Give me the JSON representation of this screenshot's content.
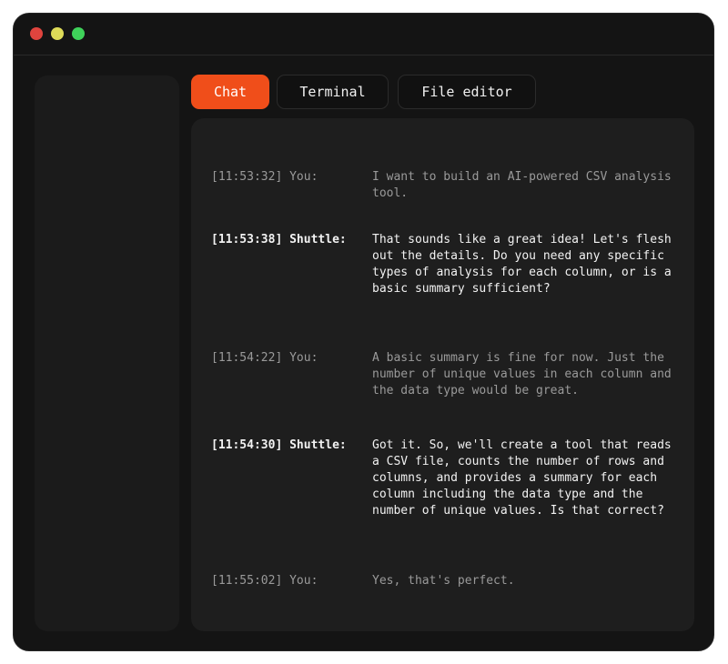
{
  "window": {
    "controls": [
      "close",
      "minimize",
      "maximize"
    ]
  },
  "tabs": [
    {
      "label": "Chat",
      "active": true
    },
    {
      "label": "Terminal",
      "active": false
    },
    {
      "label": "File editor",
      "active": false
    }
  ],
  "messages": [
    {
      "time": "[11:53:32]",
      "sender": "You:",
      "text": "I want to build an AI-powered CSV analysis tool."
    },
    {
      "time": "[11:53:38]",
      "sender": "Shuttle:",
      "text": "That sounds like a great idea! Let's flesh out the details. Do you need any specific types of analysis for each column, or is a basic summary sufficient?"
    },
    {
      "time": "[11:54:22]",
      "sender": "You:",
      "text": "A basic summary is fine for now. Just the number of unique values in each column and the data type would be great."
    },
    {
      "time": "[11:54:30]",
      "sender": "Shuttle:",
      "text": "Got it. So, we'll create a tool that reads a CSV file, counts the number of rows and columns, and provides a summary for each column including the data type and the number of unique values. Is that correct?"
    },
    {
      "time": "[11:55:02]",
      "sender": "You:",
      "text": "Yes, that's perfect."
    }
  ],
  "colors": {
    "accent": "#f04e1a",
    "window_bg": "#141414",
    "panel_bg": "#1e1e1e",
    "user_text": "#9a9a9a",
    "bot_text": "#f2f2f2"
  }
}
